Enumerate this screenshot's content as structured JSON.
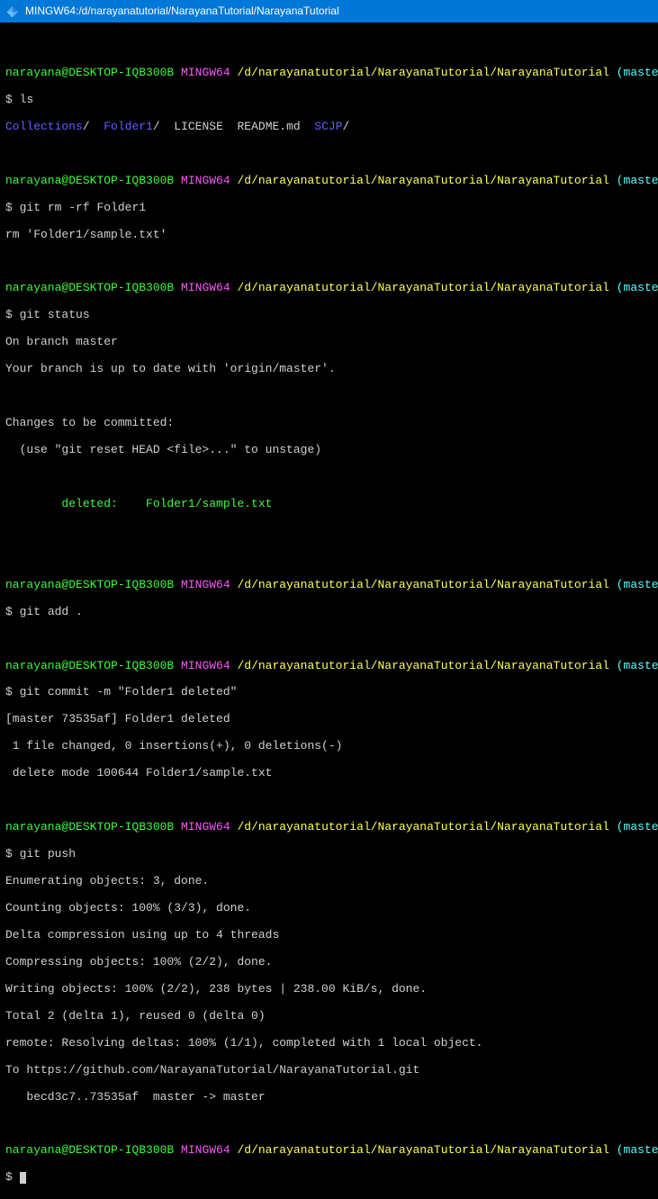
{
  "titlebar": {
    "title": "MINGW64:/d/narayanatutorial/NarayanaTutorial/NarayanaTutorial"
  },
  "prompt": {
    "user_host": "narayana@DESKTOP-IQB300B",
    "env": "MINGW64",
    "path": "/d/narayanatutorial/NarayanaTutorial/NarayanaTutorial",
    "branch": "(master)"
  },
  "dollar": "$",
  "cmd": {
    "ls": "ls",
    "git_rm": "git rm -rf Folder1",
    "git_status": "git status",
    "git_add": "git add .",
    "git_commit": "git commit -m \"Folder1 deleted\"",
    "git_push": "git push",
    "empty": ""
  },
  "ls_out": {
    "collections": "Collections",
    "folder1": "Folder1",
    "license": "LICENSE",
    "readme": "README.md",
    "scjp": "SCJP",
    "slash": "/"
  },
  "rm_out": {
    "line1": "rm 'Folder1/sample.txt'"
  },
  "status_out": {
    "line1": "On branch master",
    "line2": "Your branch is up to date with 'origin/master'.",
    "line3": "Changes to be committed:",
    "line4": "  (use \"git reset HEAD <file>...\" to unstage)",
    "deleted_label": "        deleted:    Folder1/sample.txt"
  },
  "commit_out": {
    "line1": "[master 73535af] Folder1 deleted",
    "line2": " 1 file changed, 0 insertions(+), 0 deletions(-)",
    "line3": " delete mode 100644 Folder1/sample.txt"
  },
  "push_out": {
    "line1": "Enumerating objects: 3, done.",
    "line2": "Counting objects: 100% (3/3), done.",
    "line3": "Delta compression using up to 4 threads",
    "line4": "Compressing objects: 100% (2/2), done.",
    "line5": "Writing objects: 100% (2/2), 238 bytes | 238.00 KiB/s, done.",
    "line6": "Total 2 (delta 1), reused 0 (delta 0)",
    "line7": "remote: Resolving deltas: 100% (1/1), completed with 1 local object.",
    "line8": "To https://github.com/NarayanaTutorial/NarayanaTutorial.git",
    "line9": "   becd3c7..73535af  master -> master"
  }
}
